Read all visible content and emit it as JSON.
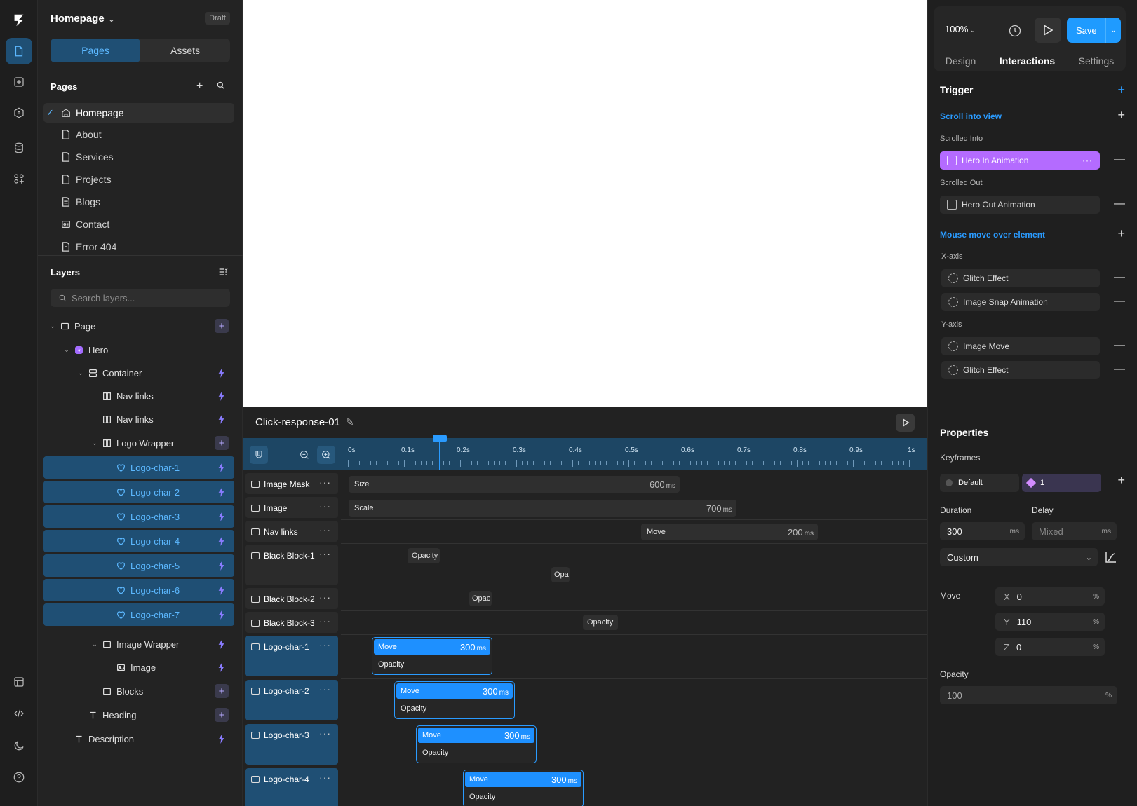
{
  "left": {
    "project": "Homepage",
    "status": "Draft",
    "tabs": [
      "Pages",
      "Assets"
    ],
    "pages_title": "Pages",
    "pages": [
      "Homepage",
      "About",
      "Services",
      "Projects",
      "Blogs",
      "Contact",
      "Error 404"
    ],
    "layers_title": "Layers",
    "search_placeholder": "Search layers...",
    "layers": [
      "Page",
      "Hero",
      "Container",
      "Nav links",
      "Nav links",
      "Logo Wrapper",
      "Logo-char-1",
      "Logo-char-2",
      "Logo-char-3",
      "Logo-char-4",
      "Logo-char-5",
      "Logo-char-6",
      "Logo-char-7",
      "Image Wrapper",
      "Image",
      "Blocks",
      "Heading",
      "Description"
    ]
  },
  "timeline": {
    "name": "Click-response-01",
    "ticks": [
      "0s",
      "0.1s",
      "0.2s",
      "0.3s",
      "0.4s",
      "0.5s",
      "0.6s",
      "0.7s",
      "0.8s",
      "0.9s",
      "1s"
    ],
    "playhead_s": 0.16,
    "tracks": [
      "Image Mask",
      "Image",
      "Nav links",
      "Black Block-1",
      "Black Block-2",
      "Black Block-3",
      "Logo-char-1",
      "Logo-char-2",
      "Logo-char-3",
      "Logo-char-4"
    ],
    "bars": {
      "size": {
        "label": "Size",
        "value": "600",
        "unit": "ms"
      },
      "scale": {
        "label": "Scale",
        "value": "700",
        "unit": "ms"
      },
      "move": {
        "label": "Move",
        "value": "200",
        "unit": "ms"
      },
      "opacity": "Opacity",
      "opa_short": "Opa",
      "opac_short": "Opac",
      "logo_move": "Move",
      "logo_value": "300",
      "logo_unit": "ms",
      "logo_opacity": "Opacity"
    }
  },
  "right": {
    "zoom": "100%",
    "save": "Save",
    "tabs": [
      "Design",
      "Interactions",
      "Settings"
    ],
    "trigger_title": "Trigger",
    "scroll_trigger": "Scroll into view",
    "scrolled_into": "Scrolled Into",
    "hero_in": "Hero In Animation",
    "scrolled_out": "Scrolled Out",
    "hero_out": "Hero Out Animation",
    "mouse_trigger": "Mouse move over element",
    "x_axis": "X-axis",
    "x_items": [
      "Glitch Effect",
      "Image Snap Animation"
    ],
    "y_axis": "Y-axis",
    "y_items": [
      "Image Move",
      "Glitch Effect"
    ],
    "properties_title": "Properties",
    "keyframes": "Keyframes",
    "kf_default": "Default",
    "kf_one": "1",
    "duration_label": "Duration",
    "delay_label": "Delay",
    "duration": "300",
    "delay": "Mixed",
    "ms": "ms",
    "easing": "Custom",
    "move_label": "Move",
    "move_x": "0",
    "move_y": "110",
    "move_z": "0",
    "pct": "%",
    "opacity_label": "Opacity",
    "opacity": "100"
  }
}
